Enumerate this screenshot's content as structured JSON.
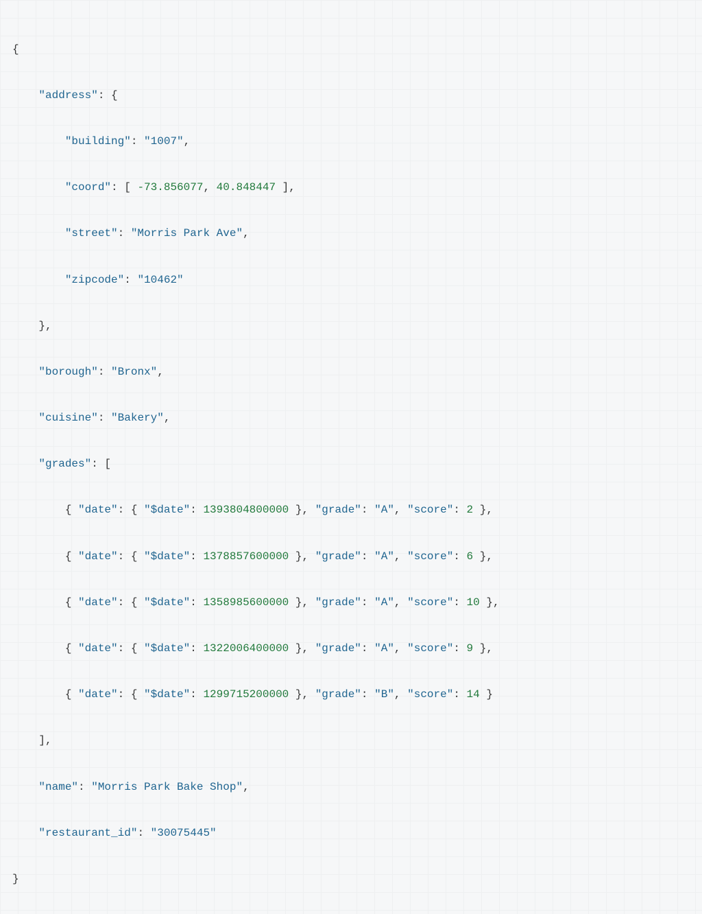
{
  "document": {
    "address": {
      "building": "1007",
      "coord": [
        -73.856077,
        40.848447
      ],
      "street": "Morris Park Ave",
      "zipcode": "10462"
    },
    "borough": "Bronx",
    "cuisine": "Bakery",
    "grades": [
      {
        "date": 1393804800000,
        "grade": "A",
        "score": 2
      },
      {
        "date": 1378857600000,
        "grade": "A",
        "score": 6
      },
      {
        "date": 1358985600000,
        "grade": "A",
        "score": 10
      },
      {
        "date": 1322006400000,
        "grade": "A",
        "score": 9
      },
      {
        "date": 1299715200000,
        "grade": "B",
        "score": 14
      }
    ],
    "name": "Morris Park Bake Shop",
    "restaurant_id": "30075445"
  },
  "labels": {
    "address": "\"address\"",
    "building": "\"building\"",
    "coord": "\"coord\"",
    "street": "\"street\"",
    "zipcode": "\"zipcode\"",
    "borough": "\"borough\"",
    "cuisine": "\"cuisine\"",
    "grades": "\"grades\"",
    "date": "\"date\"",
    "dollarDate": "\"$date\"",
    "grade": "\"grade\"",
    "score": "\"score\"",
    "name": "\"name\"",
    "restaurant_id": "\"restaurant_id\""
  },
  "values": {
    "building": "\"1007\"",
    "coord0": "-73.856077",
    "coord1": "40.848447",
    "street": "\"Morris Park Ave\"",
    "zipcode": "\"10462\"",
    "borough": "\"Bronx\"",
    "cuisine": "\"Bakery\"",
    "name": "\"Morris Park Bake Shop\"",
    "restaurant_id": "\"30075445\"",
    "gradeA": "\"A\"",
    "gradeB": "\"B\"",
    "d0": "1393804800000",
    "d1": "1378857600000",
    "d2": "1358985600000",
    "d3": "1322006400000",
    "d4": "1299715200000",
    "s0": "2",
    "s1": "6",
    "s2": "10",
    "s3": "9",
    "s4": "14"
  }
}
